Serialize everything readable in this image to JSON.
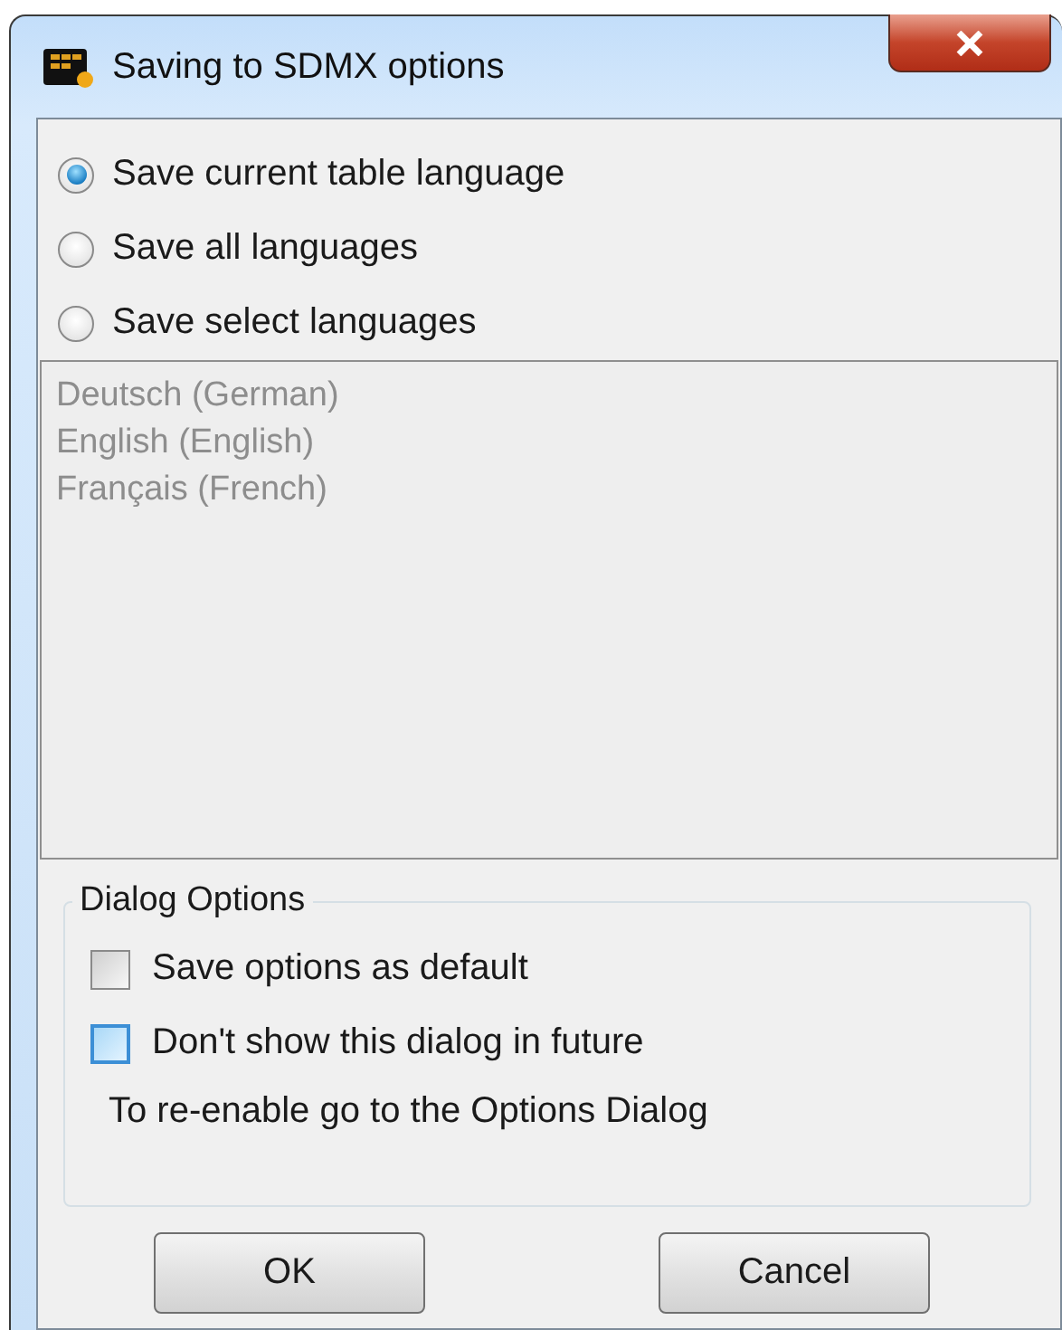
{
  "window": {
    "title": "Saving to SDMX options"
  },
  "language_options": [
    {
      "label": "Save current table language",
      "selected": true
    },
    {
      "label": "Save all languages",
      "selected": false
    },
    {
      "label": "Save select languages",
      "selected": false
    }
  ],
  "language_list": {
    "disabled": true,
    "items": [
      "Deutsch (German)",
      "English (English)",
      "Français (French)"
    ]
  },
  "dialog_options": {
    "title": "Dialog Options",
    "checkboxes": [
      {
        "label": "Save options as default",
        "checked": false,
        "hovered": false
      },
      {
        "label": "Don't show this dialog in future",
        "checked": false,
        "hovered": true
      }
    ],
    "note": "To re-enable go to the Options Dialog"
  },
  "buttons": [
    "OK",
    "Cancel"
  ]
}
